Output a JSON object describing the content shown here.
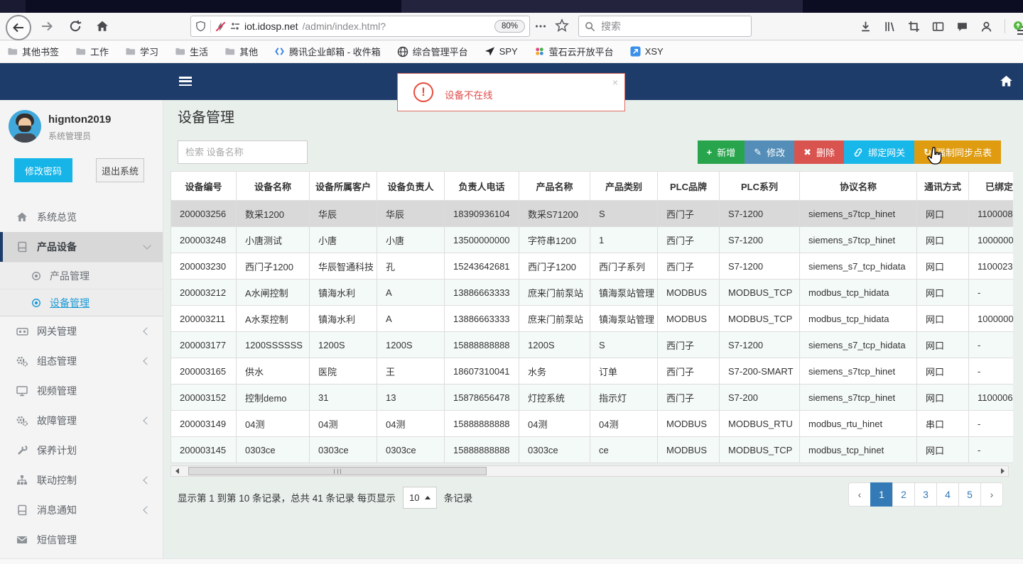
{
  "browser": {
    "url_domain": "iot.idosp.net",
    "url_path": "/admin/index.html?",
    "zoom_level": "80%",
    "search_placeholder": "搜索",
    "bookmarks": [
      {
        "label": "其他书签",
        "icon": "folder-icon"
      },
      {
        "label": "工作",
        "icon": "folder-icon"
      },
      {
        "label": "学习",
        "icon": "folder-icon"
      },
      {
        "label": "生活",
        "icon": "folder-icon"
      },
      {
        "label": "其他",
        "icon": "folder-icon"
      },
      {
        "label": "腾讯企业邮箱 - 收件箱",
        "icon": "tencent-mail-icon"
      },
      {
        "label": "综合管理平台",
        "icon": "globe-icon"
      },
      {
        "label": "SPY",
        "icon": "plane-icon"
      },
      {
        "label": "萤石云开放平台",
        "icon": "ezviz-icon"
      },
      {
        "label": "XSY",
        "icon": "xsy-icon"
      }
    ]
  },
  "alert": {
    "message": "设备不在线",
    "icon_glyph": "!",
    "close_glyph": "×"
  },
  "sidebar": {
    "user": {
      "name": "hignton2019",
      "role": "系统管理员"
    },
    "change_password": "修改密码",
    "logout": "退出系统",
    "menu": [
      {
        "label": "系统总览",
        "icon": "home-icon"
      },
      {
        "label": "产品设备",
        "icon": "book-icon",
        "expanded": true
      },
      {
        "label": "产品管理",
        "icon": "circle-dot-icon"
      },
      {
        "label": "设备管理",
        "icon": "circle-dot-icon",
        "active": true
      },
      {
        "label": "网关管理",
        "icon": "gateway-icon"
      },
      {
        "label": "组态管理",
        "icon": "gears-icon"
      },
      {
        "label": "视频管理",
        "icon": "monitor-icon"
      },
      {
        "label": "故障管理",
        "icon": "gears-icon"
      },
      {
        "label": "保养计划",
        "icon": "wrench-icon"
      },
      {
        "label": "联动控制",
        "icon": "sitemap-icon"
      },
      {
        "label": "消息通知",
        "icon": "book-icon"
      },
      {
        "label": "短信管理",
        "icon": "envelope-icon"
      }
    ]
  },
  "page": {
    "title": "设备管理",
    "search_placeholder": "检索 设备名称"
  },
  "toolbar": {
    "buttons": [
      {
        "label": "新增",
        "glyph": "+",
        "color": "#28a54c",
        "icon": "plus-icon"
      },
      {
        "label": "修改",
        "glyph": "✎",
        "color": "#548eb8",
        "icon": "pencil-icon"
      },
      {
        "label": "删除",
        "glyph": "✖",
        "color": "#d9534f",
        "icon": "x-icon"
      },
      {
        "label": "绑定网关",
        "glyph": "",
        "color": "#17b7ea",
        "icon": "link-icon"
      },
      {
        "label": "强制同步点表",
        "glyph": "↻",
        "color": "#df9c11",
        "icon": "refresh-icon"
      }
    ]
  },
  "table": {
    "selected_row": 0,
    "columns": [
      "设备编号",
      "设备名称",
      "设备所属客户",
      "设备负责人",
      "负责人电话",
      "产品名称",
      "产品类别",
      "PLC品牌",
      "PLC系列",
      "协议名称",
      "通讯方式",
      "已绑定网关"
    ],
    "rows": [
      [
        "200003256",
        "数采1200",
        "华辰",
        "华辰",
        "18390936104",
        "数采S71200",
        "S",
        "西门子",
        "S7-1200",
        "siemens_s7tcp_hinet",
        "网口",
        "1100008"
      ],
      [
        "200003248",
        "小唐测试",
        "小唐",
        "小唐",
        "13500000000",
        "字符串1200",
        "1",
        "西门子",
        "S7-1200",
        "siemens_s7tcp_hinet",
        "网口",
        "1000000"
      ],
      [
        "200003230",
        "西门子1200",
        "华辰智通科技",
        "孔",
        "15243642681",
        "西门子1200",
        "西门子系列",
        "西门子",
        "S7-1200",
        "siemens_s7_tcp_hidata",
        "网口",
        "1100023"
      ],
      [
        "200003212",
        "A水闸控制",
        "镇海水利",
        "A",
        "13886663333",
        "庶来门前泵站",
        "镇海泵站管理",
        "MODBUS",
        "MODBUS_TCP",
        "modbus_tcp_hidata",
        "网口",
        "-"
      ],
      [
        "200003211",
        "A水泵控制",
        "镇海水利",
        "A",
        "13886663333",
        "庶来门前泵站",
        "镇海泵站管理",
        "MODBUS",
        "MODBUS_TCP",
        "modbus_tcp_hidata",
        "网口",
        "1000000"
      ],
      [
        "200003177",
        "1200SSSSSS",
        "1200S",
        "1200S",
        "15888888888",
        "1200S",
        "S",
        "西门子",
        "S7-1200",
        "siemens_s7_tcp_hidata",
        "网口",
        "-"
      ],
      [
        "200003165",
        "供水",
        "医院",
        "王",
        "18607310041",
        "水务",
        "订单",
        "西门子",
        "S7-200-SMART",
        "siemens_s7tcp_hinet",
        "网口",
        "-"
      ],
      [
        "200003152",
        "控制demo",
        "31",
        "13",
        "15878656478",
        "灯控系统",
        "指示灯",
        "西门子",
        "S7-200",
        "siemens_s7tcp_hinet",
        "网口",
        "1100006"
      ],
      [
        "200003149",
        "04测",
        "04测",
        "04测",
        "15888888888",
        "04测",
        "04测",
        "MODBUS",
        "MODBUS_RTU",
        "modbus_rtu_hinet",
        "串口",
        "-"
      ],
      [
        "200003145",
        "0303ce",
        "0303ce",
        "0303ce",
        "15888888888",
        "0303ce",
        "ce",
        "MODBUS",
        "MODBUS_TCP",
        "modbus_tcp_hinet",
        "网口",
        "-"
      ]
    ]
  },
  "footer": {
    "summary": "显示第 1 到第 10 条记录，总共 41 条记录 每页显示",
    "page_size": "10",
    "suffix": "条记录",
    "prev": "‹",
    "next": "›",
    "pages": [
      "1",
      "2",
      "3",
      "4",
      "5"
    ],
    "active_page": "1"
  }
}
